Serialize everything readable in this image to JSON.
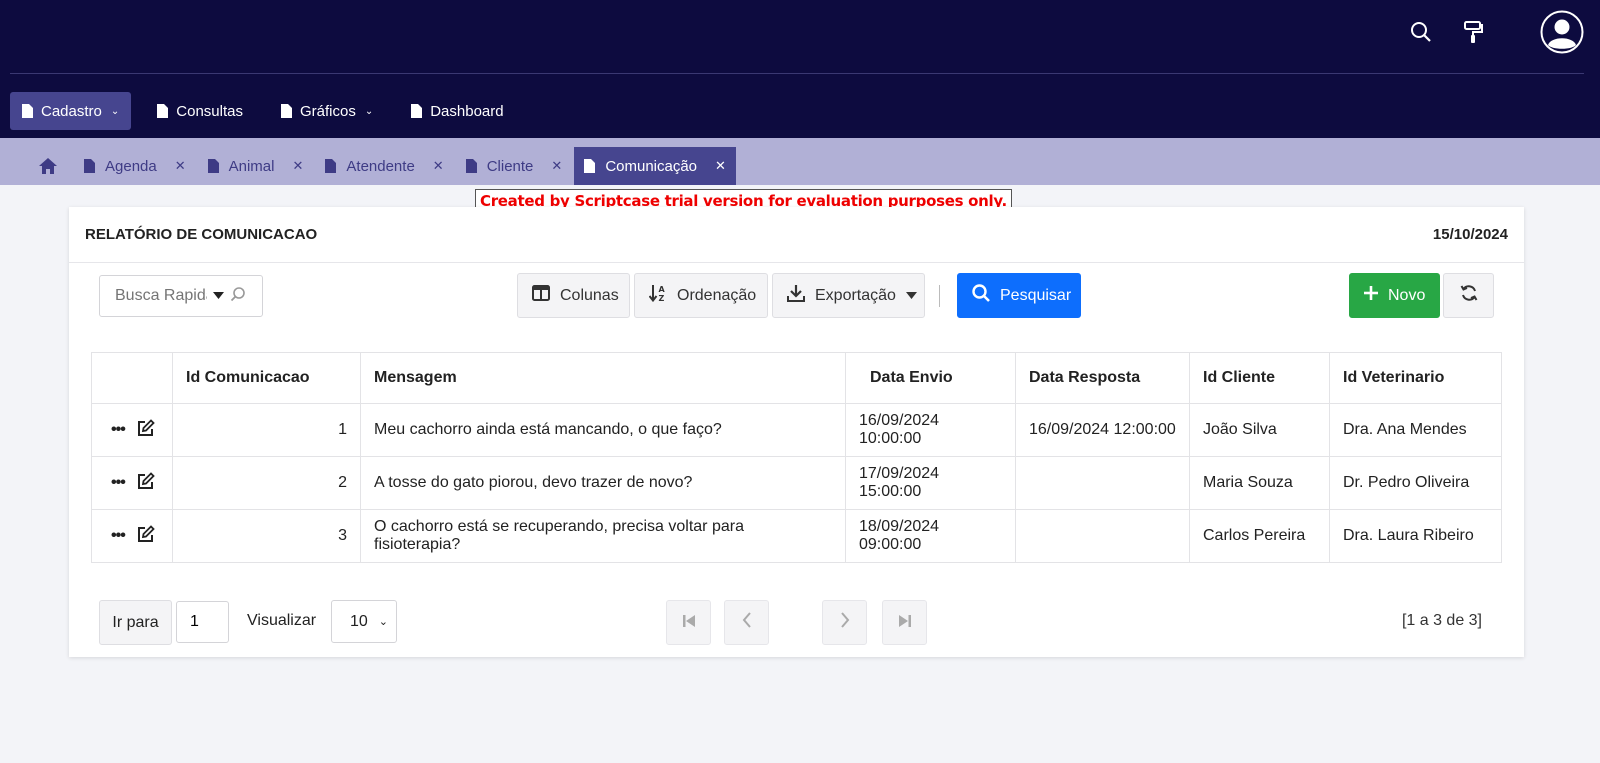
{
  "nav": {
    "items": [
      {
        "label": "Cadastro"
      },
      {
        "label": "Consultas"
      },
      {
        "label": "Gráficos"
      },
      {
        "label": "Dashboard"
      }
    ]
  },
  "tabs": [
    {
      "label": "Agenda"
    },
    {
      "label": "Animal"
    },
    {
      "label": "Atendente"
    },
    {
      "label": "Cliente"
    },
    {
      "label": "Comunicação"
    }
  ],
  "trial_notice": "Created by Scriptcase trial version for evaluation purposes only.",
  "report": {
    "title": "RELATÓRIO DE COMUNICACAO",
    "date": "15/10/2024"
  },
  "toolbar": {
    "search_placeholder": "Busca Rapida",
    "columns_label": "Colunas",
    "sort_label": "Ordenação",
    "export_label": "Exportação",
    "search_label": "Pesquisar",
    "new_label": "Novo"
  },
  "table": {
    "headers": [
      "Id Comunicacao",
      "Mensagem",
      "Data Envio",
      "Data Resposta",
      "Id Cliente",
      "Id Veterinario"
    ],
    "rows": [
      {
        "id": "1",
        "mensagem": "Meu cachorro ainda está mancando, o que faço?",
        "envio": "16/09/2024 10:00:00",
        "resposta": "16/09/2024 12:00:00",
        "cliente": "João Silva",
        "veterinario": "Dra. Ana Mendes"
      },
      {
        "id": "2",
        "mensagem": "A tosse do gato piorou, devo trazer de novo?",
        "envio": "17/09/2024 15:00:00",
        "resposta": "",
        "cliente": "Maria Souza",
        "veterinario": "Dr. Pedro Oliveira"
      },
      {
        "id": "3",
        "mensagem": "O cachorro está se recuperando, precisa voltar para fisioterapia?",
        "envio": "18/09/2024 09:00:00",
        "resposta": "",
        "cliente": "Carlos Pereira",
        "veterinario": "Dra. Laura Ribeiro"
      }
    ]
  },
  "footer": {
    "goto_label": "Ir para",
    "goto_value": "1",
    "view_label": "Visualizar",
    "view_value": "10",
    "current_page": "1",
    "range_text": "[1 a 3 de 3]"
  }
}
